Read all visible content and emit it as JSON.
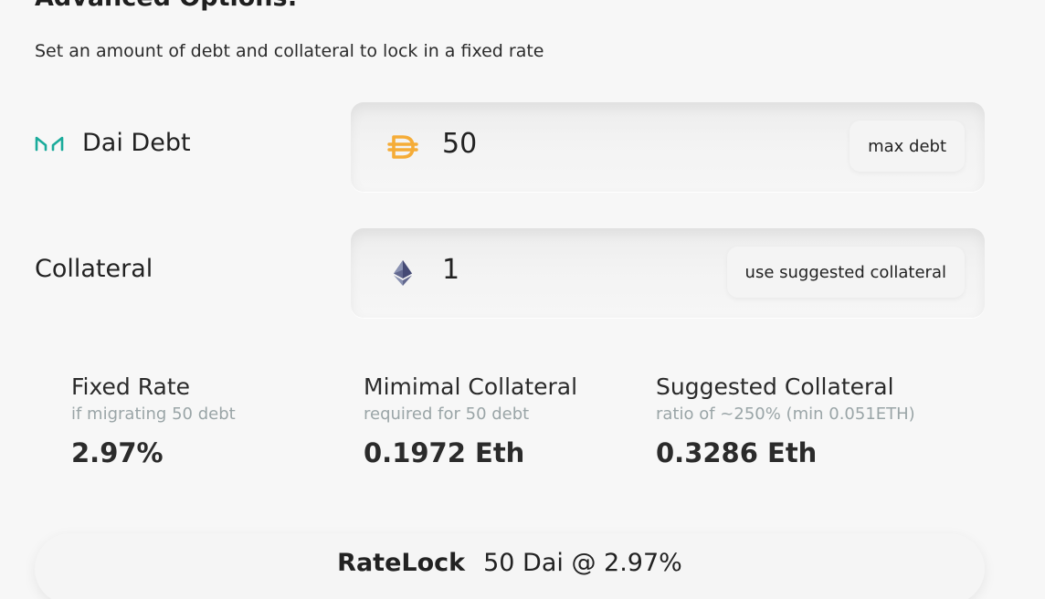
{
  "header": {
    "title": "Advanced Options:",
    "subtitle": "Set an amount of debt and collateral to lock in a fixed rate"
  },
  "debt": {
    "label": "Dai Debt",
    "icon": "maker-logo-icon",
    "token_icon": "dai-icon",
    "value": "50",
    "button": "max debt",
    "icon_color": "#1aab9b",
    "token_color": "#f5ac37"
  },
  "collateral": {
    "label": "Collateral",
    "token_icon": "ethereum-icon",
    "value": "1",
    "button": "use suggested collateral"
  },
  "stats": [
    {
      "title": "Fixed Rate",
      "subtitle": "if migrating 50 debt",
      "value": "2.97%"
    },
    {
      "title": "Mimimal Collateral",
      "subtitle": "required for 50 debt",
      "value": "0.1972 Eth"
    },
    {
      "title": "Suggested Collateral",
      "subtitle": "ratio of ~250% (min 0.051ETH)",
      "value": "0.3286 Eth"
    }
  ],
  "action": {
    "label": "RateLock",
    "summary": "50 Dai @ 2.97%"
  }
}
